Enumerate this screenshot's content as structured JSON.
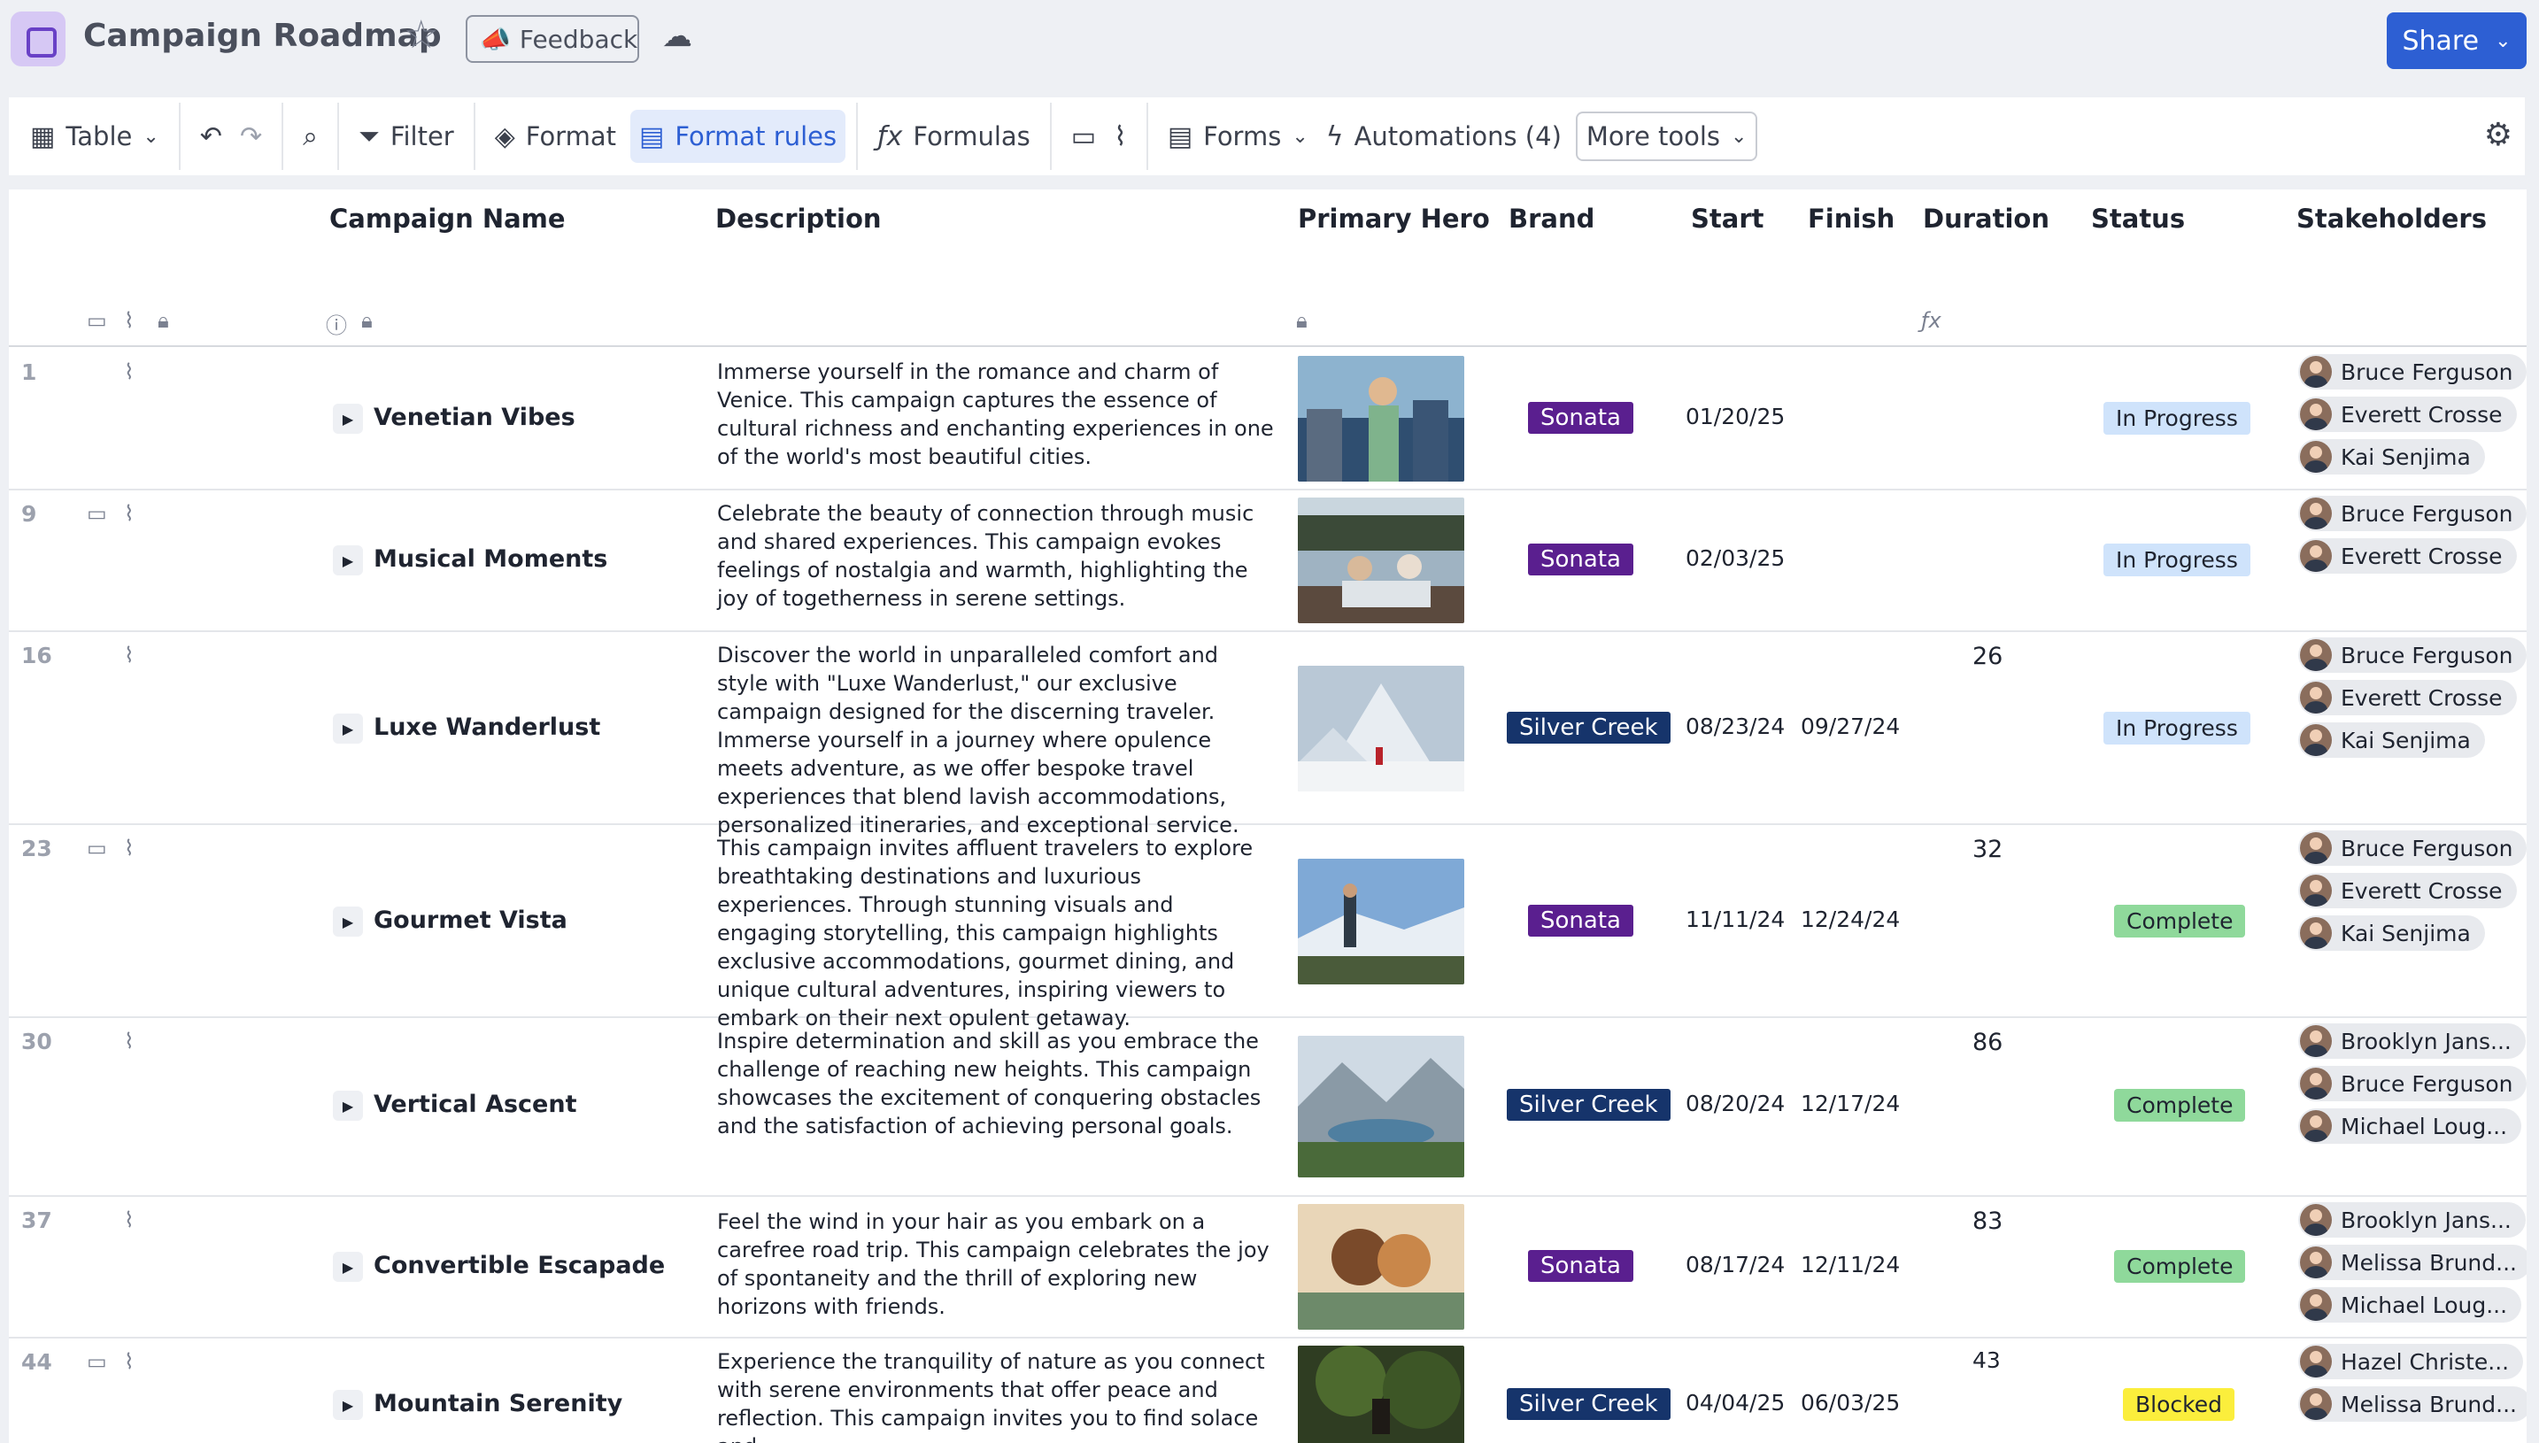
{
  "header": {
    "title": "Campaign Roadmap",
    "feedback_label": "Feedback",
    "share_label": "Share"
  },
  "toolbar": {
    "view_label": "Table",
    "filter_label": "Filter",
    "format_label": "Format",
    "format_rules_label": "Format rules",
    "formulas_label": "Formulas",
    "forms_label": "Forms",
    "automations_label": "Automations (4)",
    "more_tools_label": "More tools"
  },
  "columns": {
    "campaign_name": "Campaign Name",
    "description": "Description",
    "primary_hero": "Primary Hero",
    "brand": "Brand",
    "start": "Start",
    "finish": "Finish",
    "duration": "Duration",
    "status": "Status",
    "stakeholders": "Stakeholders"
  },
  "colors": {
    "accent": "#2d5fd3",
    "sonata": "#5a1f8f",
    "silver_creek": "#16346b",
    "in_progress": "#cfe3fb",
    "complete": "#8fd99b",
    "blocked": "#fbee3c"
  },
  "rows": [
    {
      "num": "1",
      "name": "Venetian Vibes",
      "description": "Immerse yourself in the romance and charm of Venice. This campaign captures the essence of cultural richness and enchanting experiences in one of the world's most beautiful cities.",
      "brand": "Sonata",
      "start": "01/20/25",
      "finish": "",
      "duration": "",
      "status": "In Progress",
      "stakeholders": [
        "Bruce Ferguson",
        "Everett Crosse",
        "Kai Senjima"
      ]
    },
    {
      "num": "9",
      "name": "Musical Moments",
      "description": "Celebrate the beauty of connection through music and shared experiences. This campaign evokes feelings of nostalgia and warmth, highlighting the joy of togetherness in serene settings.",
      "brand": "Sonata",
      "start": "02/03/25",
      "finish": "",
      "duration": "",
      "status": "In Progress",
      "stakeholders": [
        "Bruce Ferguson",
        "Everett Crosse"
      ]
    },
    {
      "num": "16",
      "name": "Luxe Wanderlust",
      "description": "Discover the world in unparalleled comfort and style with \"Luxe Wanderlust,\" our exclusive campaign designed for the discerning traveler. Immerse yourself in a journey where opulence meets adventure, as we offer bespoke travel experiences that blend lavish accommodations, personalized itineraries, and exceptional service.",
      "brand": "Silver Creek",
      "start": "08/23/24",
      "finish": "09/27/24",
      "duration": "26",
      "status": "In Progress",
      "stakeholders": [
        "Bruce Ferguson",
        "Everett Crosse",
        "Kai Senjima"
      ]
    },
    {
      "num": "23",
      "name": "Gourmet Vista",
      "description": "This campaign invites affluent travelers to explore breathtaking destinations and luxurious experiences. Through stunning visuals and engaging storytelling, this campaign highlights exclusive accommodations, gourmet dining, and unique cultural adventures, inspiring viewers to embark on their next opulent getaway.",
      "brand": "Sonata",
      "start": "11/11/24",
      "finish": "12/24/24",
      "duration": "32",
      "status": "Complete",
      "stakeholders": [
        "Bruce Ferguson",
        "Everett Crosse",
        "Kai Senjima"
      ]
    },
    {
      "num": "30",
      "name": "Vertical Ascent",
      "description": "Inspire determination and skill as you embrace the challenge of reaching new heights. This campaign showcases the excitement of conquering obstacles and the satisfaction of achieving personal goals.",
      "brand": "Silver Creek",
      "start": "08/20/24",
      "finish": "12/17/24",
      "duration": "86",
      "status": "Complete",
      "stakeholders": [
        "Brooklyn Jans...",
        "Bruce Ferguson",
        "Michael Loug..."
      ]
    },
    {
      "num": "37",
      "name": "Convertible Escapade",
      "description": "Feel the wind in your hair as you embark on a carefree road trip. This campaign celebrates the joy of spontaneity and the thrill of exploring new horizons with friends.",
      "brand": "Sonata",
      "start": "08/17/24",
      "finish": "12/11/24",
      "duration": "83",
      "status": "Complete",
      "stakeholders": [
        "Brooklyn Jans...",
        "Melissa Brund...",
        "Michael Loug..."
      ]
    },
    {
      "num": "44",
      "name": "Mountain Serenity",
      "description": "Experience the tranquility of nature as you connect with serene environments that offer peace and reflection. This campaign invites you to find solace and",
      "brand": "Silver Creek",
      "start": "04/04/25",
      "finish": "06/03/25",
      "duration": "43",
      "status": "Blocked",
      "stakeholders": [
        "Hazel Christe...",
        "Melissa Brund..."
      ]
    }
  ]
}
